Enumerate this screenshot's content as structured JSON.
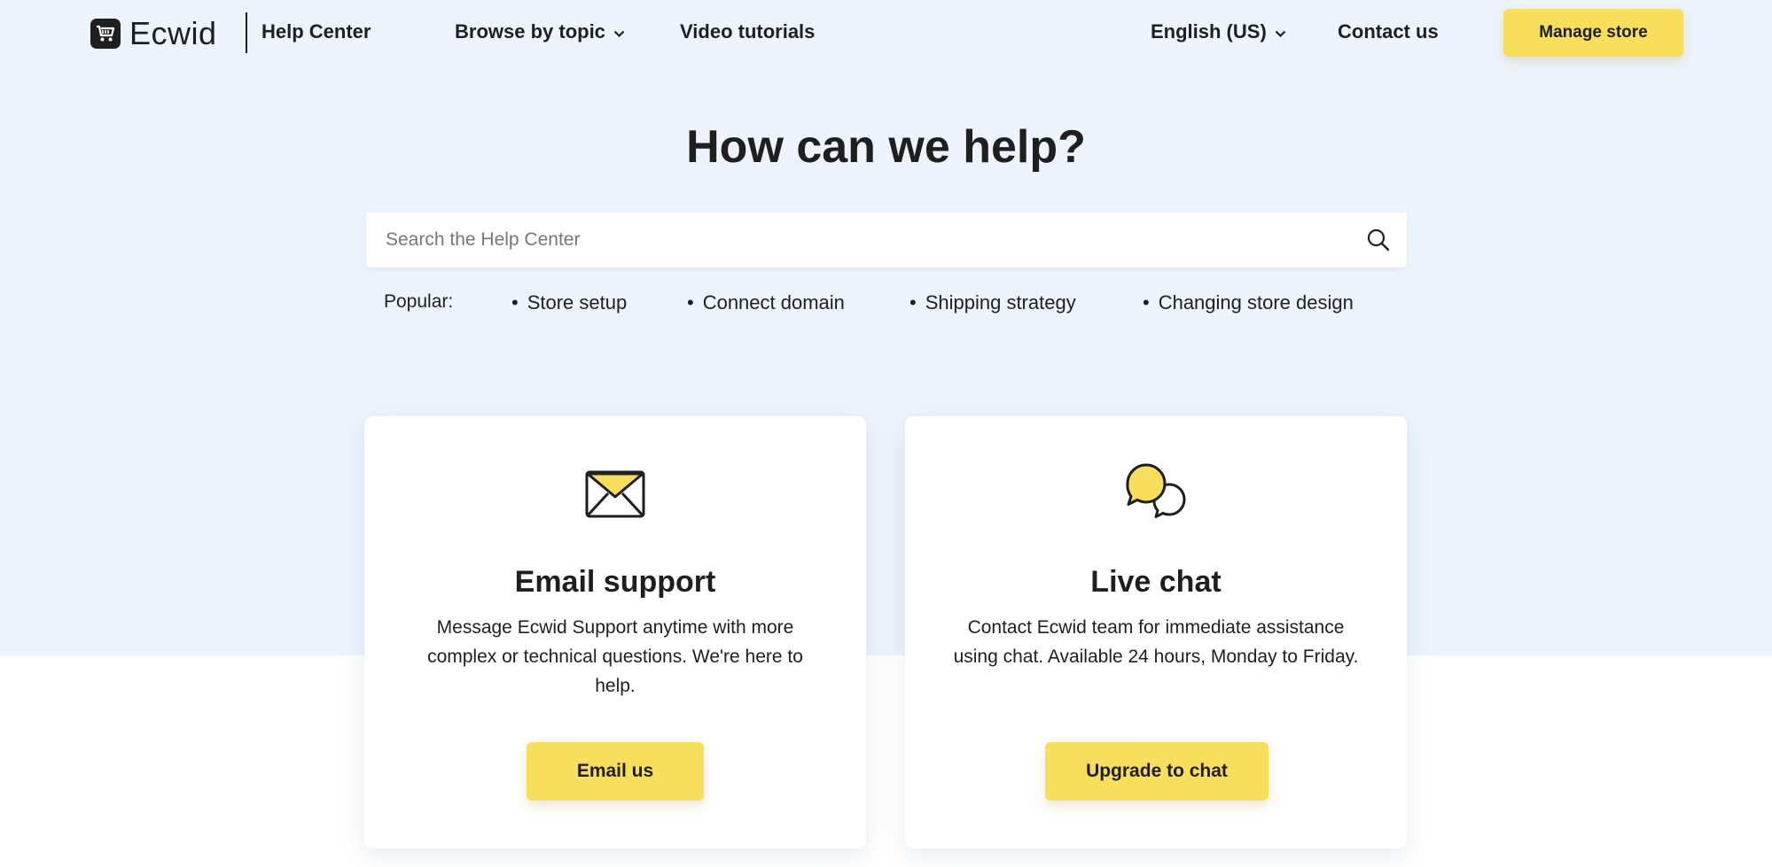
{
  "header": {
    "logo_text": "Ecwid",
    "section_title": "Help Center",
    "nav": {
      "browse": "Browse by topic",
      "videos": "Video tutorials",
      "language": "English (US)",
      "contact": "Contact us"
    },
    "manage_store_label": "Manage store"
  },
  "hero": {
    "title": "How can we help?",
    "search_placeholder": "Search the Help Center",
    "popular_label": "Popular:",
    "popular_links": [
      "Store setup",
      "Connect domain",
      "Shipping strategy",
      "Changing store design"
    ]
  },
  "cards": [
    {
      "icon": "envelope-icon",
      "title": "Email support",
      "description": "Message Ecwid Support anytime with more complex or technical questions. We're here to help.",
      "button": "Email us"
    },
    {
      "icon": "chat-bubbles-icon",
      "title": "Live chat",
      "description": "Contact Ecwid team for immediate assistance using chat. Available 24 hours, Monday to Friday.",
      "button": "Upgrade to chat"
    }
  ],
  "colors": {
    "accent": "#f7df5d",
    "hero_background": "#edf4fd",
    "text": "#1f1f1f"
  }
}
